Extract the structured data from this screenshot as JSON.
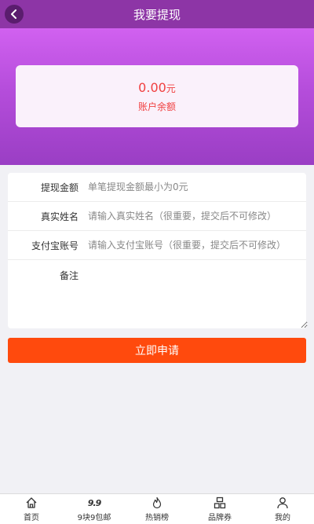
{
  "header": {
    "title": "我要提现",
    "back_icon": "chevron-left-icon"
  },
  "colors": {
    "header_bg": "#8d35a6",
    "accent": "#ff4a0d",
    "amount": "#f04040"
  },
  "balance": {
    "amount": "0.00",
    "unit": "元",
    "label": "账户余额"
  },
  "form": {
    "amount": {
      "label": "提现金额",
      "placeholder": "单笔提现金额最小为0元",
      "value": ""
    },
    "name": {
      "label": "真实姓名",
      "placeholder": "请输入真实姓名（很重要，提交后不可修改）",
      "value": ""
    },
    "alipay": {
      "label": "支付宝账号",
      "placeholder": "请输入支付宝账号（很重要，提交后不可修改）",
      "value": ""
    },
    "note": {
      "label": "备注",
      "value": ""
    }
  },
  "submit_label": "立即申请",
  "tabbar": [
    {
      "label": "首页",
      "icon": "home-icon"
    },
    {
      "label": "9块9包邮",
      "icon": "nine-nine-icon",
      "icon_text": "9.9"
    },
    {
      "label": "热销榜",
      "icon": "flame-icon"
    },
    {
      "label": "品牌券",
      "icon": "brand-icon"
    },
    {
      "label": "我的",
      "icon": "user-icon"
    }
  ]
}
